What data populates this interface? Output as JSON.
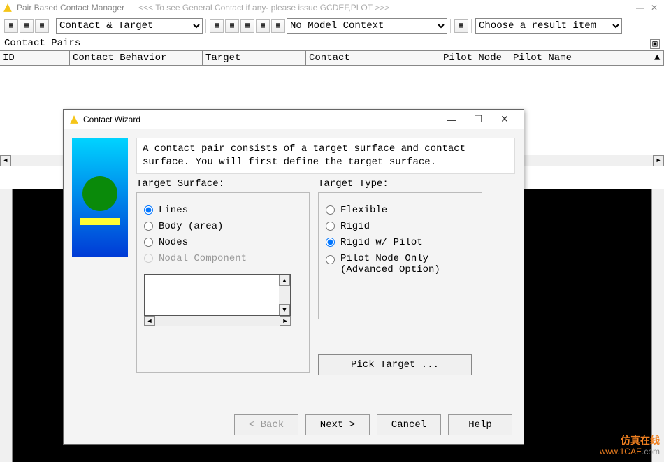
{
  "main_window": {
    "title": "Pair Based Contact Manager",
    "hint": "<<< To see General Contact if any- please issue GCDEF,PLOT >>>"
  },
  "toolbar": {
    "combo1": "Contact & Target",
    "combo2": "No Model Context",
    "combo3": "Choose a result item"
  },
  "contact_pairs_label": "Contact Pairs",
  "table_headers": {
    "id": "ID",
    "cb": "Contact Behavior",
    "tg": "Target",
    "ct": "Contact",
    "pn": "Pilot Node",
    "pname": "Pilot Name"
  },
  "wizard": {
    "title": "Contact Wizard",
    "description": "A contact pair consists of a target surface and contact surface.  You will first define the target surface.",
    "target_surface_label": "Target Surface:",
    "target_type_label": "Target Type:",
    "surface_options": {
      "lines": "Lines",
      "body": "Body (area)",
      "nodes": "Nodes",
      "nodal_comp": "Nodal Component"
    },
    "type_options": {
      "flexible": "Flexible",
      "rigid": "Rigid",
      "rigid_pilot": "Rigid w/ Pilot",
      "pilot_only_l1": "Pilot Node Only",
      "pilot_only_l2": "(Advanced Option)"
    },
    "pick_button": "Pick Target ...",
    "buttons": {
      "back": "Back",
      "next": "Next >",
      "cancel": "Cancel",
      "help": "Help"
    }
  },
  "watermark": "1CAE.COM",
  "logo": {
    "l1": "仿真在线",
    "l2a": "www.1CAE",
    "l2b": ".com"
  }
}
